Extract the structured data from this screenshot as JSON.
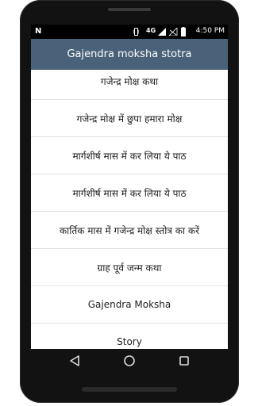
{
  "statusbar": {
    "notification_icon": "N",
    "network": "4G",
    "time": "4:50 PM"
  },
  "appbar": {
    "title": "Gajendra moksha stotra"
  },
  "list": {
    "items": [
      "गजेन्द्र मोक्ष कथा",
      "गजेन्द्र मोक्ष में छुपा हमारा मोक्ष",
      "मार्गशीर्ष मास में कर लिया ये पाठ",
      "मार्गशीर्ष मास में कर लिया ये पाठ",
      "कार्तिक मास में गजेन्द्र मोक्ष स्तोत्र का करें",
      "ग्राह पूर्व जन्म कथा",
      "Gajendra Moksha",
      "Story"
    ]
  },
  "icons": {
    "status": [
      "vibrate-icon",
      "signal-icon",
      "battery-icon"
    ],
    "nav": [
      "back-icon",
      "home-icon",
      "recent-apps-icon"
    ]
  },
  "colors": {
    "appbar": "#4a6279",
    "statusbar": "#000000",
    "phone_frame": "#121212"
  }
}
